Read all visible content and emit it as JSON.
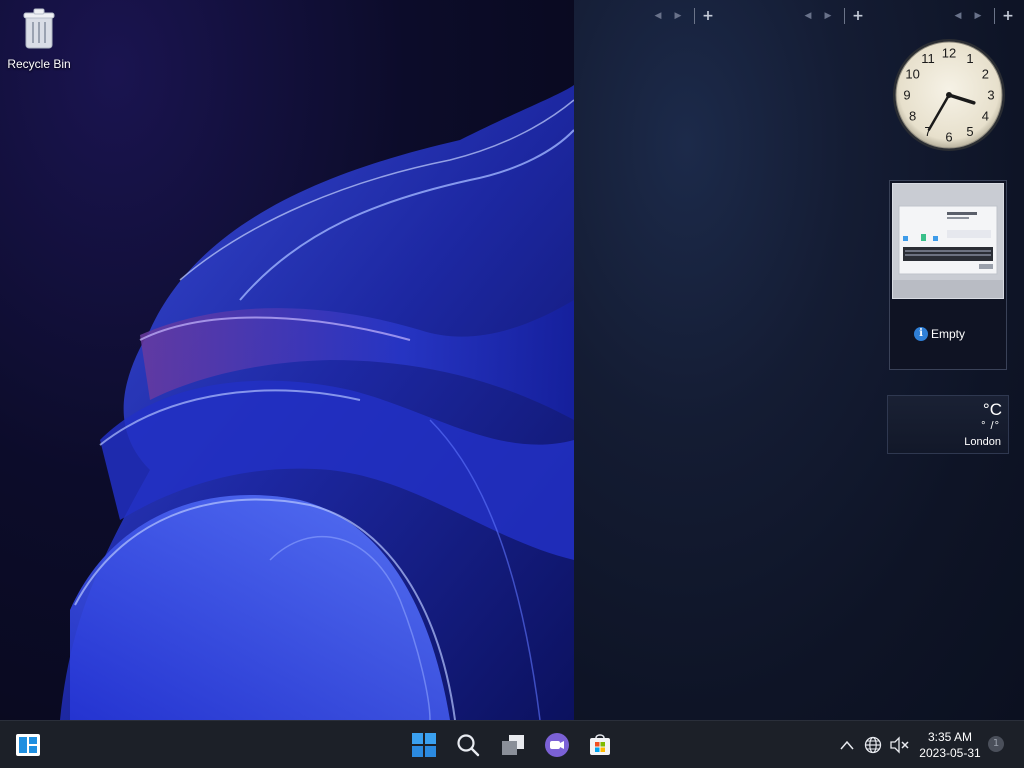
{
  "desktop": {
    "icons": [
      {
        "label": "Recycle Bin",
        "icon": "recycle-bin-icon"
      }
    ]
  },
  "sidebar": {
    "control_groups": [
      {
        "prev": "◀",
        "next": "▶",
        "add": "+"
      },
      {
        "prev": "◀",
        "next": "▶",
        "add": "+"
      },
      {
        "prev": "◀",
        "next": "▶",
        "add": "+"
      }
    ],
    "clock_gadget": {
      "time": "3:35",
      "numerals": [
        "12",
        "1",
        "2",
        "3",
        "4",
        "5",
        "6",
        "7",
        "8",
        "9",
        "10",
        "11"
      ]
    },
    "slideshow_gadget": {
      "status_icon": "info-icon",
      "status_text": "Empty"
    },
    "weather_gadget": {
      "temperature": "°C",
      "range": "° /°",
      "city": "London"
    }
  },
  "taskbar": {
    "left_app": "widgets-icon",
    "center_apps": [
      "start-icon",
      "search-icon",
      "task-view-icon",
      "teams-chat-icon",
      "store-icon"
    ],
    "tray_icons": [
      "chevron-up-icon",
      "network-globe-icon",
      "speaker-muted-icon"
    ],
    "clock_time": "3:35 AM",
    "clock_date": "2023-05-31",
    "notification_count": "1"
  },
  "colors": {
    "accent": "#2f7fd6",
    "taskbar": "#1c2028",
    "sidebar": "#141c33"
  }
}
